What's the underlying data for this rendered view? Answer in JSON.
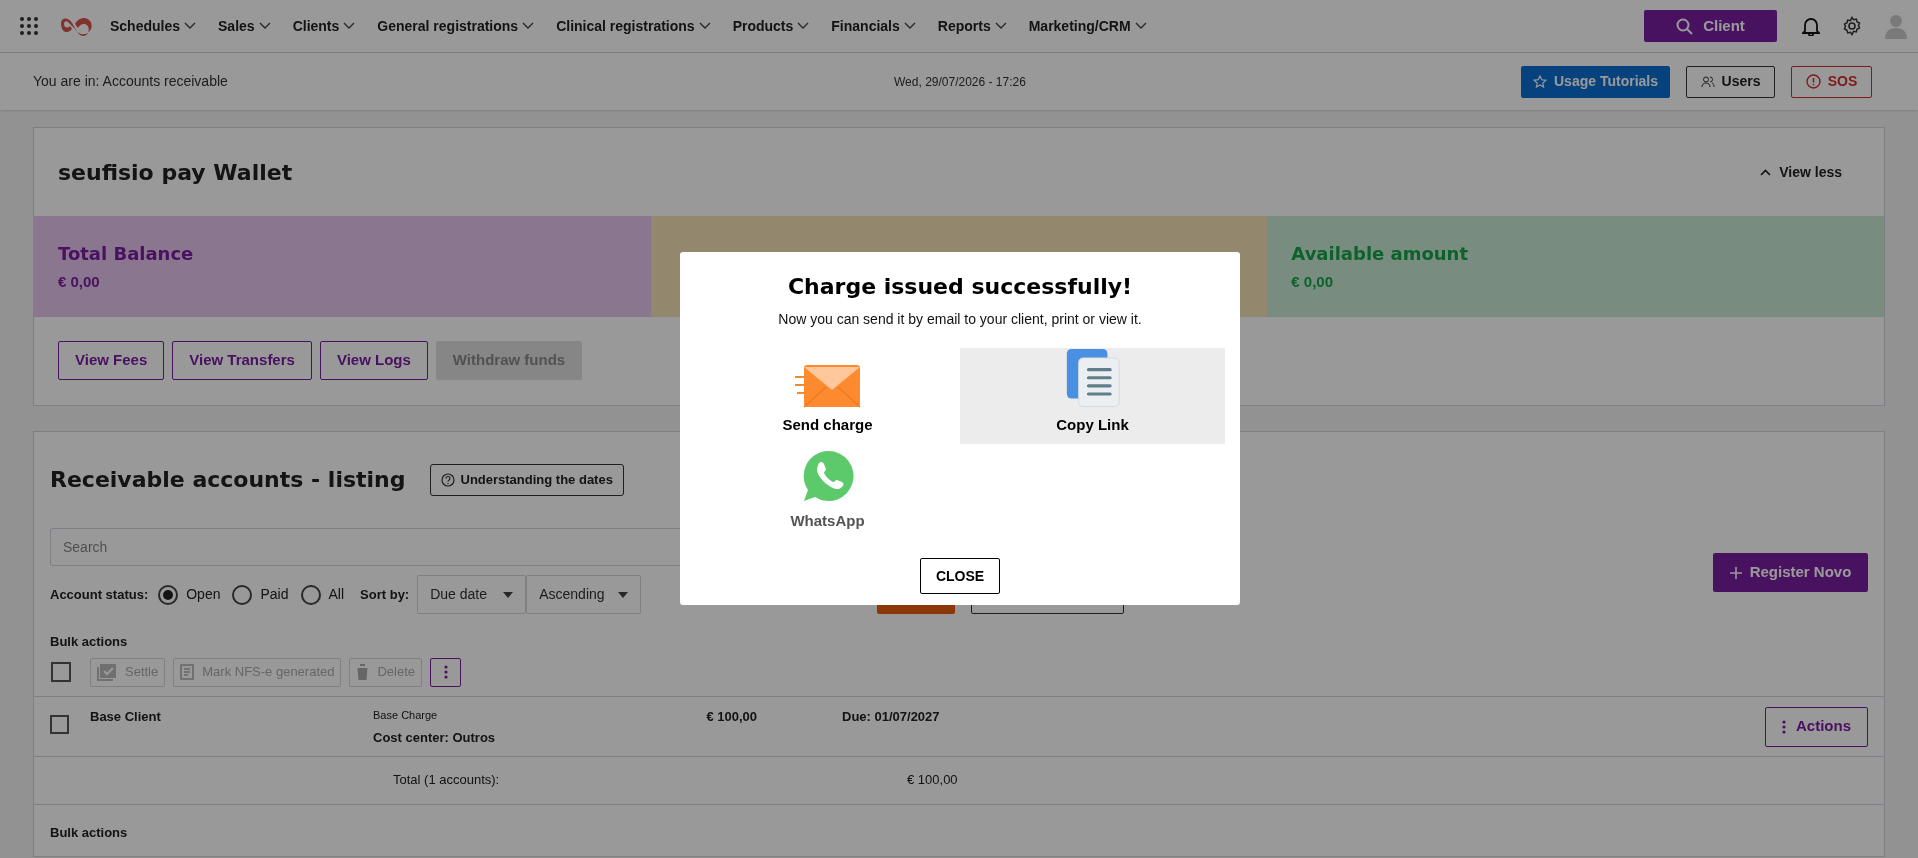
{
  "nav": {
    "items": [
      "Schedules",
      "Sales",
      "Clients",
      "General registrations",
      "Clinical registrations",
      "Products",
      "Financials",
      "Reports",
      "Marketing/CRM"
    ],
    "search_button": "Client"
  },
  "breadcrumb": {
    "text": "You are in: Accounts receivable",
    "datetime": "Wed, 29/07/2026 - 17:26",
    "buttons": [
      {
        "label": "Usage Tutorials",
        "kind": "tutorials"
      },
      {
        "label": "Users",
        "kind": "users"
      },
      {
        "label": "SOS",
        "kind": "sos"
      }
    ]
  },
  "wallet": {
    "title": "seufisio pay Wallet",
    "toggle": "View less",
    "tiles": [
      {
        "kind": "total",
        "title": "Total Balance",
        "amount": "€ 0,00"
      },
      {
        "kind": "pending"
      },
      {
        "kind": "available",
        "title": "Available amount",
        "amount": "€ 0,00"
      }
    ],
    "buttons": [
      {
        "label": "View Fees",
        "disabled": false
      },
      {
        "label": "View Transfers",
        "disabled": false
      },
      {
        "label": "View Logs",
        "disabled": false
      },
      {
        "label": "Withdraw funds",
        "disabled": true
      }
    ]
  },
  "listing": {
    "title": "Receivable accounts - listing",
    "help_button": "Understanding the dates",
    "search": {
      "placeholder": "Search"
    },
    "register_button": "Register Novo",
    "status_label": "Account status:",
    "statuses": [
      {
        "label": "Open",
        "selected": true
      },
      {
        "label": "Paid",
        "selected": false
      },
      {
        "label": "All",
        "selected": false
      }
    ],
    "sort_label": "Sort by:",
    "sort_field": "Due date",
    "sort_order": "Ascending",
    "bulk_label": "Bulk actions",
    "select_all_checked": false,
    "bulk_actions": [
      {
        "label": "Settle",
        "kind": "settle"
      },
      {
        "label": "Mark NFS-e generated",
        "kind": "nfse"
      },
      {
        "label": "Delete",
        "kind": "delete"
      }
    ],
    "rows": [
      {
        "client": "Base Client",
        "charge": "Base Charge",
        "cost_center": "Cost center: Outros",
        "amount": "€ 100,00",
        "due": "Due: 01/07/2027",
        "checked": false,
        "actions": "Actions"
      }
    ],
    "total_label": "Total (1 accounts):",
    "total_amount": "€ 100,00",
    "bulk_label_2": "Bulk actions"
  },
  "modal": {
    "title": "Charge issued successfully!",
    "subtitle": "Now you can send it by email to your client, print or view it.",
    "options": [
      {
        "label": "Send charge",
        "kind": "email",
        "highlighted": false
      },
      {
        "label": "Copy Link",
        "kind": "link",
        "highlighted": true
      },
      {
        "label": "WhatsApp",
        "kind": "whatsapp",
        "highlighted": false
      }
    ],
    "close": "CLOSE"
  }
}
